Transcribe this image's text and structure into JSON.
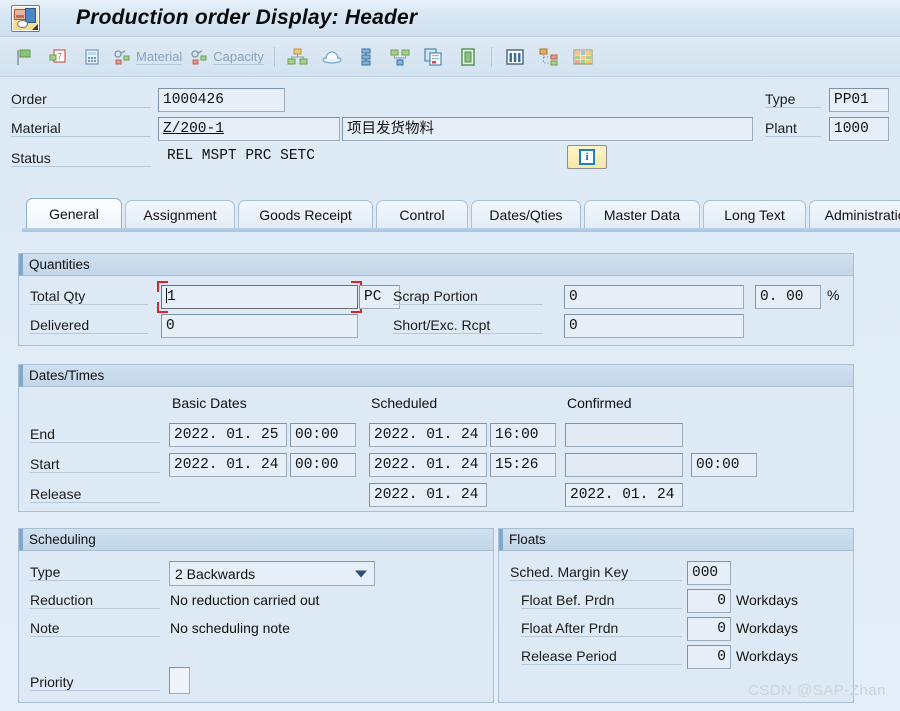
{
  "window": {
    "title": "Production order Display: Header",
    "app_icon": "production-order-icon"
  },
  "toolbar": {
    "buttons": [
      {
        "icon": "flag-icon",
        "label": ""
      },
      {
        "icon": "calendar-document-icon",
        "label": ""
      },
      {
        "icon": "calculator-icon",
        "label": ""
      },
      {
        "icon": "material-icon",
        "label": "Material"
      },
      {
        "icon": "capacity-icon",
        "label": "Capacity"
      },
      {
        "icon": "network-icon",
        "label": ""
      },
      {
        "icon": "hat-icon",
        "label": ""
      },
      {
        "icon": "sequence-icon",
        "label": ""
      },
      {
        "icon": "hierarchy-icon",
        "label": ""
      },
      {
        "icon": "copy-document-icon",
        "label": ""
      },
      {
        "icon": "clipboard-icon",
        "label": ""
      },
      {
        "icon": "columns-icon",
        "label": ""
      },
      {
        "icon": "structure-list-icon",
        "label": ""
      },
      {
        "icon": "grid-icon",
        "label": ""
      }
    ]
  },
  "header": {
    "order_label": "Order",
    "order_value": "1000426",
    "material_label": "Material",
    "material_value": "Z/200-1",
    "material_desc": "项目发货物料",
    "status_label": "Status",
    "status_value": "REL  MSPT PRC  SETC",
    "info_button": "i",
    "type_label": "Type",
    "type_value": "PP01",
    "plant_label": "Plant",
    "plant_value": "1000"
  },
  "tabs": [
    {
      "label": "General",
      "active": true
    },
    {
      "label": "Assignment",
      "active": false
    },
    {
      "label": "Goods Receipt",
      "active": false
    },
    {
      "label": "Control",
      "active": false
    },
    {
      "label": "Dates/Qties",
      "active": false
    },
    {
      "label": "Master Data",
      "active": false
    },
    {
      "label": "Long Text",
      "active": false
    },
    {
      "label": "Administration",
      "active": false
    }
  ],
  "quantities": {
    "title": "Quantities",
    "total_qty_label": "Total Qty",
    "total_qty_value": "1",
    "total_qty_unit": "PC",
    "delivered_label": "Delivered",
    "delivered_value": "0",
    "scrap_label": "Scrap Portion",
    "scrap_value": "0",
    "scrap_pct_value": "0. 00",
    "scrap_pct_unit": "%",
    "short_exc_label": "Short/Exc. Rcpt",
    "short_exc_value": "0"
  },
  "dates_times": {
    "title": "Dates/Times",
    "col_basic": "Basic Dates",
    "col_scheduled": "Scheduled",
    "col_confirmed": "Confirmed",
    "rows": [
      {
        "label": "End",
        "basic_date": "2022. 01. 25",
        "basic_time": "00:00",
        "sched_date": "2022. 01. 24",
        "sched_time": "16:00",
        "conf_date": "",
        "conf_time": ""
      },
      {
        "label": "Start",
        "basic_date": "2022. 01. 24",
        "basic_time": "00:00",
        "sched_date": "2022. 01. 24",
        "sched_time": "15:26",
        "conf_date": "",
        "conf_time": "00:00"
      },
      {
        "label": "Release",
        "basic_date": "",
        "basic_time": "",
        "sched_date": "2022. 01. 24",
        "sched_time": "",
        "conf_date": "2022. 01. 24",
        "conf_time": ""
      }
    ]
  },
  "scheduling": {
    "title": "Scheduling",
    "type_label": "Type",
    "type_value": "2 Backwards",
    "reduction_label": "Reduction",
    "reduction_value": "No reduction carried out",
    "note_label": "Note",
    "note_value": "No scheduling note",
    "priority_label": "Priority",
    "priority_value": ""
  },
  "floats": {
    "title": "Floats",
    "margin_key_label": "Sched. Margin Key",
    "margin_key_value": "000",
    "rows": [
      {
        "label": "Float Bef. Prdn",
        "value": "0",
        "unit": "Workdays"
      },
      {
        "label": "Float After Prdn",
        "value": "0",
        "unit": "Workdays"
      },
      {
        "label": "Release Period",
        "value": "0",
        "unit": "Workdays"
      }
    ]
  },
  "watermark": "CSDN @SAP-Zhan",
  "colors": {
    "accent": "#7ba7cf",
    "panel": "#dde9f4",
    "field": "#e6eef7",
    "focus": "#d7262b",
    "info_button": "#f7e8a8"
  }
}
